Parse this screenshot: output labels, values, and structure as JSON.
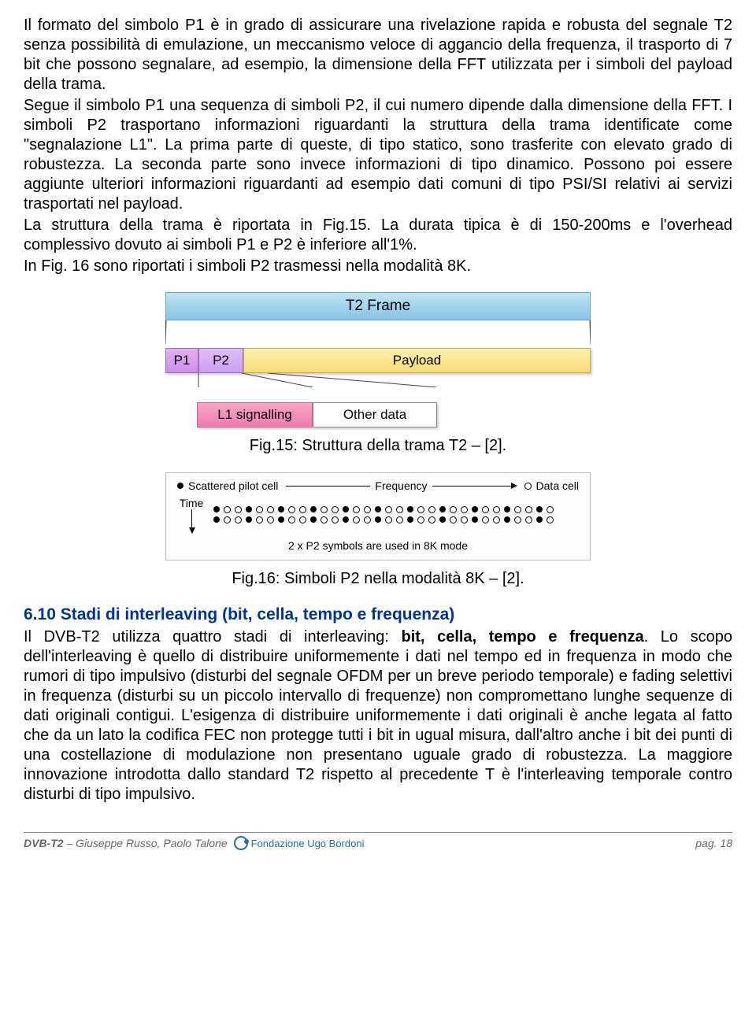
{
  "paragraphs": {
    "p1": "Il formato del simbolo P1 è in grado di assicurare una rivelazione rapida e robusta del segnale T2 senza possibilità di emulazione, un meccanismo veloce di aggancio della frequenza, il trasporto di 7 bit che possono segnalare, ad esempio, la dimensione della FFT utilizzata per i simboli del payload della trama.",
    "p2": "Segue il simbolo P1 una sequenza di simboli P2, il cui numero dipende dalla dimensione della FFT. I simboli P2 trasportano informazioni riguardanti la struttura della trama identificate come \"segnalazione L1\". La prima parte di queste, di tipo statico, sono trasferite con elevato grado di robustezza. La seconda parte sono invece informazioni di tipo dinamico. Possono poi essere aggiunte ulteriori informazioni riguardanti ad esempio dati comuni di tipo PSI/SI relativi ai servizi trasportati nel payload.",
    "p3": "La struttura della trama è riportata in Fig.15. La durata tipica è di 150-200ms e l'overhead complessivo dovuto ai simboli P1 e P2 è inferiore all'1%.",
    "p4": "In Fig. 16 sono riportati i simboli P2 trasmessi nella modalità 8K."
  },
  "fig15": {
    "t2frame": "T2 Frame",
    "p1": "P1",
    "p2": "P2",
    "payload": "Payload",
    "l1sig": "L1 signalling",
    "other": "Other data",
    "caption": "Fig.15: Struttura della trama T2 – [2]."
  },
  "fig16": {
    "scattered": "Scattered pilot cell",
    "frequency": "Frequency",
    "data_cell": "Data cell",
    "time": "Time",
    "note": "2 x P2 symbols are used in 8K mode",
    "caption": "Fig.16: Simboli P2 nella modalità 8K – [2]."
  },
  "section": {
    "num_title": "6.10  Stadi di interleaving (bit, cella, tempo e frequenza)",
    "body_pre": "Il DVB-T2 utilizza quattro stadi di interleaving: ",
    "body_bold": "bit, cella, tempo e frequenza",
    "body_post": ". Lo scopo dell'interleaving è quello di distribuire uniformemente i dati nel tempo ed in frequenza in modo che rumori di tipo impulsivo (disturbi del segnale OFDM per un breve periodo temporale) e fading selettivi in frequenza (disturbi su un piccolo intervallo di frequenze) non compromettano lunghe sequenze di dati originali contigui. L'esigenza di distribuire uniformemente i dati originali è anche legata al fatto che da un lato la codifica FEC non protegge tutti i bit in ugual misura, dall'altro anche i bit dei punti di una costellazione di modulazione non presentano uguale grado di robustezza. La maggiore innovazione introdotta dallo standard T2 rispetto al precedente T è l'interleaving temporale contro disturbi di tipo impulsivo."
  },
  "footer": {
    "dvb": "DVB-T2",
    "authors": " –  Giuseppe Russo, Paolo Talone",
    "logo": "Fondazione Ugo Bordoni",
    "page": "pag. 18"
  }
}
